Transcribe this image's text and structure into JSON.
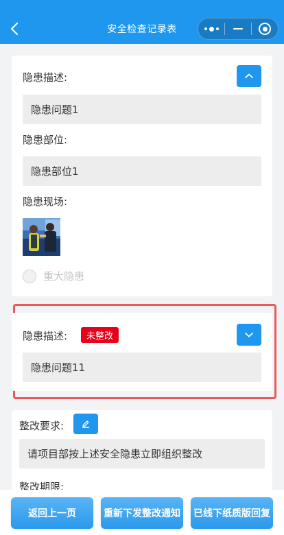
{
  "navbar": {
    "title": "安全检查记录表"
  },
  "record1": {
    "desc_label": "隐患描述:",
    "desc_value": "隐患问题1",
    "location_label": "隐患部位:",
    "location_value": "隐患部位1",
    "scene_label": "隐患现场:",
    "major_label": "重大隐患",
    "major_checked": false
  },
  "record2": {
    "desc_label": "隐患描述:",
    "status_badge": "未整改",
    "desc_value": "隐患问题11"
  },
  "rectify": {
    "requirement_label": "整改要求:",
    "requirement_value": "请项目部按上述安全隐患立即组织整改",
    "deadline_label": "整改期限:"
  },
  "actions": {
    "back": "返回上一页",
    "reissue": "重新下发整改通知",
    "offline": "已线下纸质版回复"
  },
  "colors": {
    "primary": "#1f97ee",
    "badge": "#e5001b",
    "highlight": "#e85a5a"
  }
}
